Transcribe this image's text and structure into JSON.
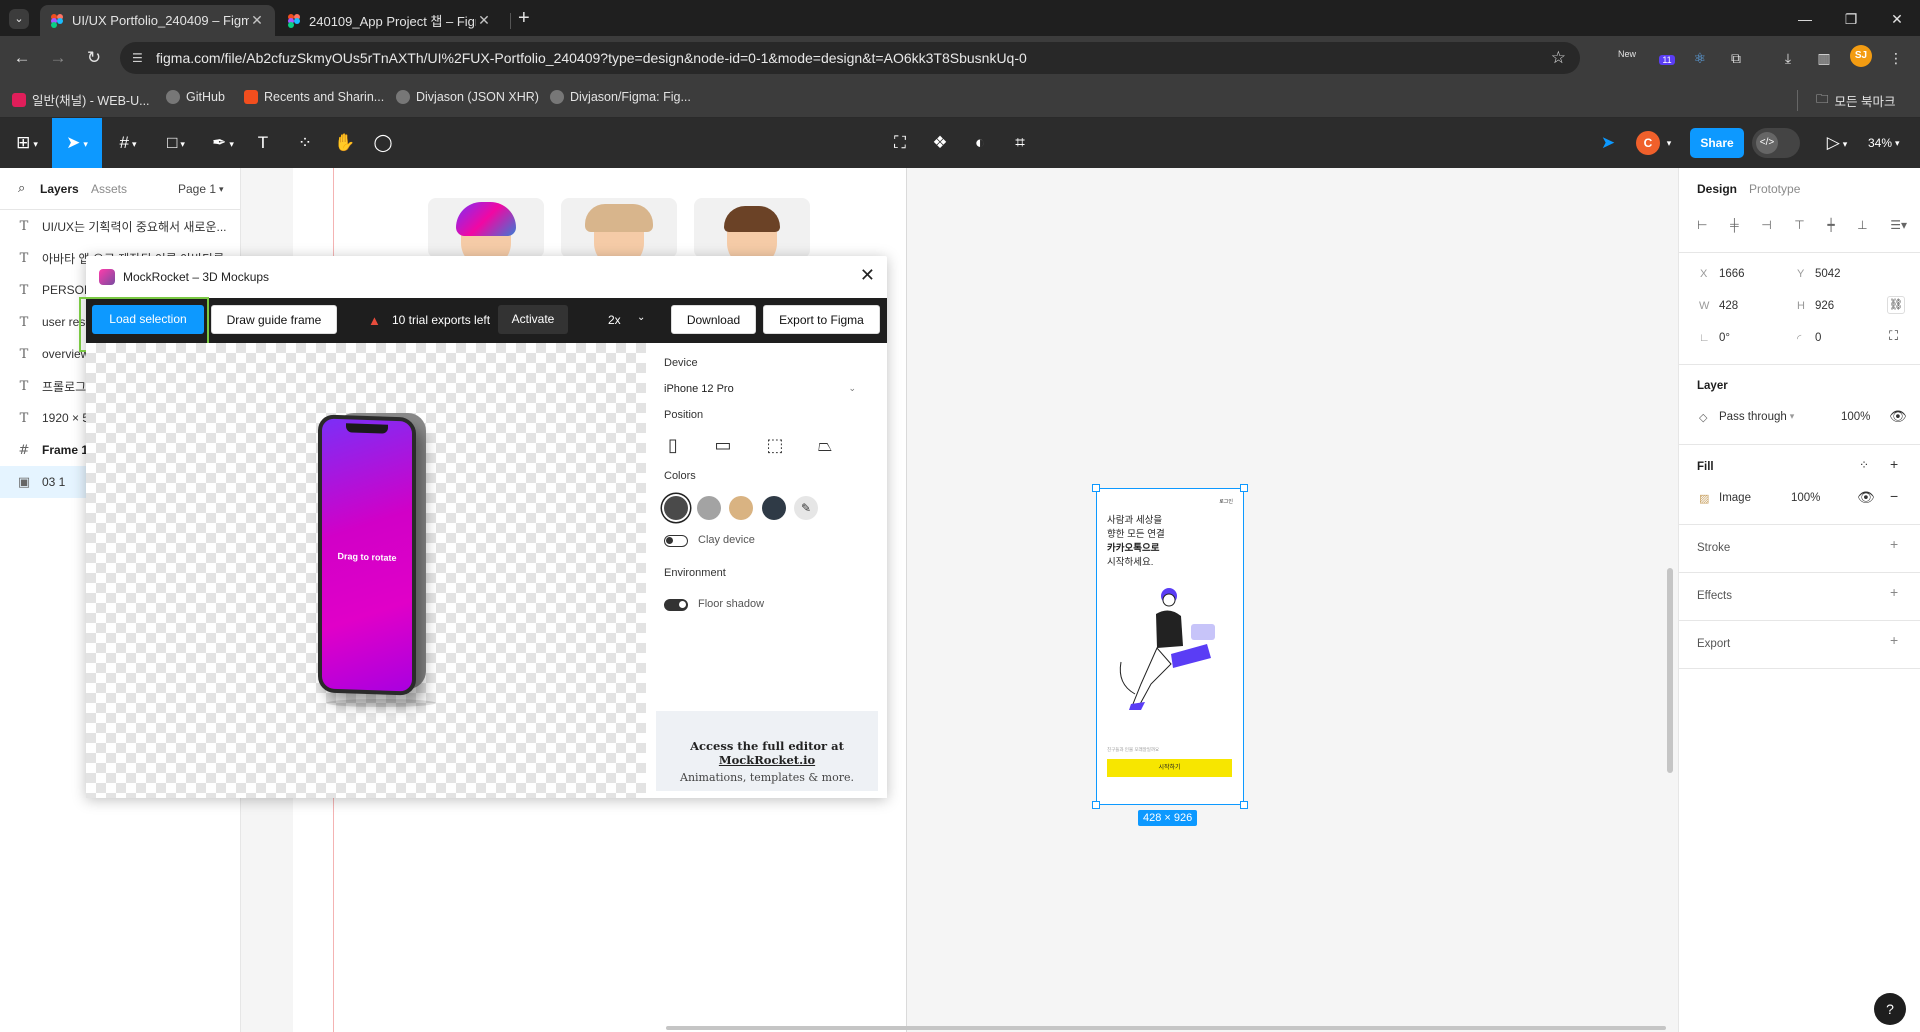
{
  "browser": {
    "tabs": [
      {
        "title": "UI/UX Portfolio_240409 – Figma",
        "active": true
      },
      {
        "title": "240109_App Project 챕 – Figma",
        "active": false
      }
    ],
    "url": "figma.com/file/Ab2cfuzSkmyOUs5rTnAXTh/UI%2FUX-Portfolio_240409?type=design&node-id=0-1&mode=design&t=AO6kk3T8SbusnkUq-0",
    "ext_badge_new": "New",
    "ext_badge_count": "11",
    "profile_initials": "SJ",
    "bookmarks": [
      "일반(채널) - WEB-U...",
      "GitHub",
      "Recents and Sharin...",
      "Divjason (JSON XHR)",
      "Divjason/Figma: Fig..."
    ],
    "all_bookmarks": "모든 북마크"
  },
  "figma_toolbar": {
    "user_initial": "C",
    "share_label": "Share",
    "zoom": "34%"
  },
  "left_panel": {
    "tabs": {
      "layers": "Layers",
      "assets": "Assets",
      "page": "Page 1"
    },
    "layers": [
      {
        "icon": "T",
        "name": "UI/UX는 기획력이 중요해서 새로운..."
      },
      {
        "icon": "T",
        "name": "아바타 앱 으로 제작된 이름 아바타를"
      },
      {
        "icon": "T",
        "name": "PERSONA"
      },
      {
        "icon": "T",
        "name": "user research"
      },
      {
        "icon": "T",
        "name": "overview"
      },
      {
        "icon": "T",
        "name": "프롤로그"
      },
      {
        "icon": "T",
        "name": "1920 × 5"
      },
      {
        "icon": "#",
        "name": "Frame 1"
      },
      {
        "icon": "▣",
        "name": "03 1"
      }
    ]
  },
  "canvas": {
    "phone": {
      "login": "로그인",
      "headline_lines": [
        "사람과 세상을",
        "향한 모든 연결",
        "카카오톡으로",
        "시작하세요."
      ],
      "small_text": "친구들과 인물 모래알일까요",
      "cta": "시작하기"
    },
    "dimension_badge": "428 × 926"
  },
  "right_panel": {
    "tabs": {
      "design": "Design",
      "prototype": "Prototype"
    },
    "x_label": "X",
    "x": "1666",
    "y_label": "Y",
    "y": "5042",
    "w_label": "W",
    "w": "428",
    "h_label": "H",
    "h": "926",
    "rotation": "0°",
    "radius": "0",
    "layer_title": "Layer",
    "blend_mode": "Pass through",
    "layer_opacity": "100%",
    "fill_title": "Fill",
    "fill_type": "Image",
    "fill_opacity": "100%",
    "stroke_title": "Stroke",
    "effects_title": "Effects",
    "export_title": "Export",
    "help": "?"
  },
  "plugin": {
    "title": "MockRocket – 3D Mockups",
    "load_selection": "Load selection",
    "draw_guide": "Draw guide frame",
    "trial_text": "10 trial exports left",
    "activate": "Activate",
    "scale": "2x",
    "download": "Download",
    "export": "Export to Figma",
    "drag_hint": "Drag to rotate",
    "device_label": "Device",
    "device_value": "iPhone 12 Pro",
    "position_label": "Position",
    "colors_label": "Colors",
    "swatch_colors": [
      "#4a4a4a",
      "#a3a3a3",
      "#d9b382",
      "#2f3a46"
    ],
    "clay_label": "Clay device",
    "environment_label": "Environment",
    "floor_shadow_label": "Floor shadow",
    "promo_prefix": "Access the full editor at ",
    "promo_link": "MockRocket.io",
    "promo_line2": "Animations, templates & more."
  }
}
